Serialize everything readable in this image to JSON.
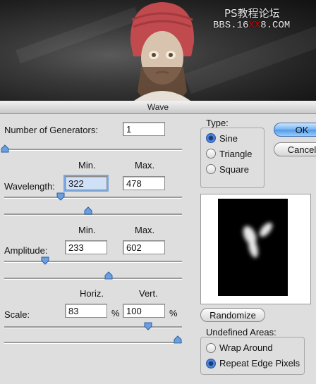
{
  "banner": {
    "watermark_line1": "PS教程论坛",
    "watermark_line2_a": "BBS.16",
    "watermark_line2_b": "XX",
    "watermark_line2_c": "8.COM"
  },
  "dialog": {
    "title": "Wave",
    "generators": {
      "label": "Number of Generators:",
      "value": "1"
    },
    "wavelength": {
      "label": "Wavelength:",
      "min_header": "Min.",
      "max_header": "Max.",
      "min": "322",
      "max": "478"
    },
    "amplitude": {
      "label": "Amplitude:",
      "min_header": "Min.",
      "max_header": "Max.",
      "min": "233",
      "max": "602"
    },
    "scale": {
      "label": "Scale:",
      "horiz_header": "Horiz.",
      "vert_header": "Vert.",
      "horiz": "83",
      "vert": "100",
      "unit": "%"
    },
    "type": {
      "label": "Type:",
      "options": [
        "Sine",
        "Triangle",
        "Square"
      ],
      "selected": "Sine"
    },
    "buttons": {
      "ok": "OK",
      "cancel": "Cancel",
      "randomize": "Randomize"
    },
    "undefined_areas": {
      "label": "Undefined Areas:",
      "options": [
        "Wrap Around",
        "Repeat Edge Pixels"
      ],
      "selected": "Repeat Edge Pixels"
    }
  }
}
